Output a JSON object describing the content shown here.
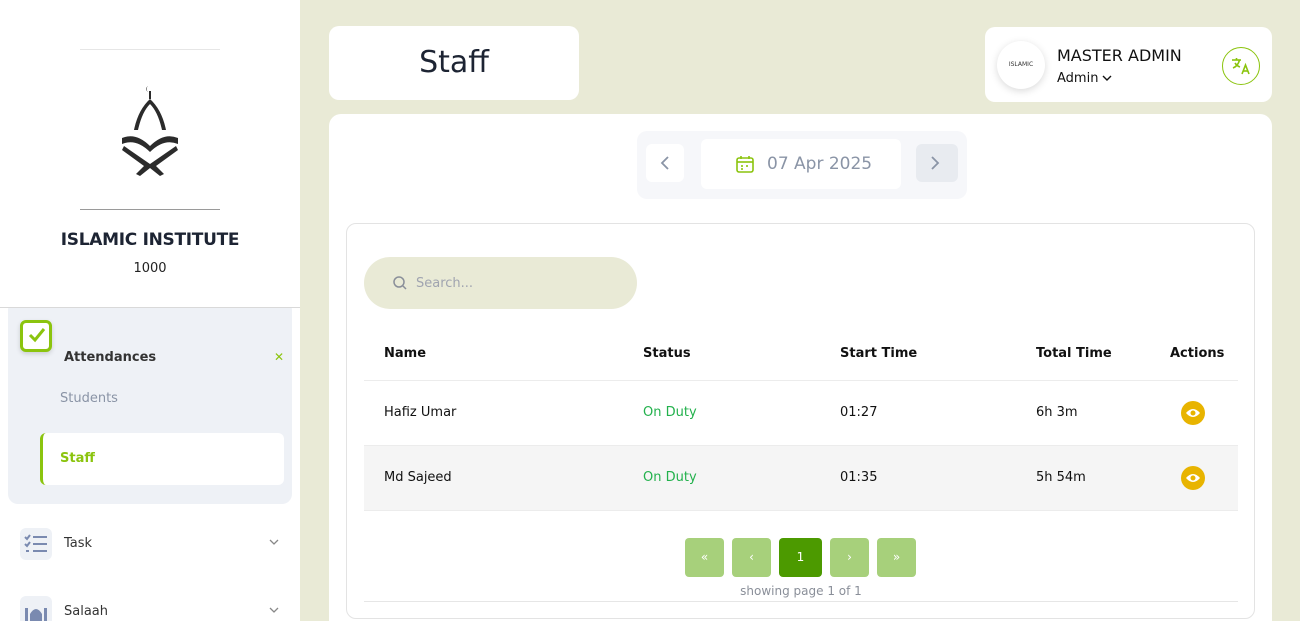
{
  "sidebar": {
    "institute_name": "ISLAMIC INSTITUTE",
    "institute_code": "1000",
    "attendances": {
      "label": "Attendances",
      "items": [
        {
          "label": "Students"
        },
        {
          "label": "Staff"
        }
      ]
    },
    "menu": [
      {
        "label": "Task"
      },
      {
        "label": "Salaah"
      }
    ]
  },
  "header": {
    "page_title": "Staff",
    "user_name": "MASTER ADMIN",
    "user_role": "Admin",
    "avatar_text": "ISLAMIC"
  },
  "date_nav": {
    "date": "07 Apr 2025"
  },
  "table": {
    "search_placeholder": "Search...",
    "columns": [
      "Name",
      "Status",
      "Start Time",
      "Total Time",
      "Actions"
    ],
    "rows": [
      {
        "name": "Hafiz Umar",
        "status": "On Duty",
        "start_time": "01:27",
        "total_time": "6h 3m"
      },
      {
        "name": "Md Sajeed",
        "status": "On Duty",
        "start_time": "01:35",
        "total_time": "5h 54m"
      }
    ]
  },
  "pagination": {
    "first": "«",
    "prev": "‹",
    "current": "1",
    "next": "›",
    "last": "»",
    "info": "showing page 1 of 1"
  },
  "colors": {
    "accent": "#8bc40e",
    "active_page": "#4c9a00",
    "inactive_page": "#a7d07b",
    "status_on_duty": "#22b14c",
    "eye_button": "#e8b400",
    "page_bg": "#e9ead6"
  },
  "icons": {
    "logo": "mosque-quran-icon",
    "attendance": "checkbox-icon",
    "task": "task-list-icon",
    "salaah": "mosque-icon",
    "translate": "translate-icon",
    "calendar": "calendar-icon",
    "search": "search-icon",
    "view": "eye-icon"
  }
}
